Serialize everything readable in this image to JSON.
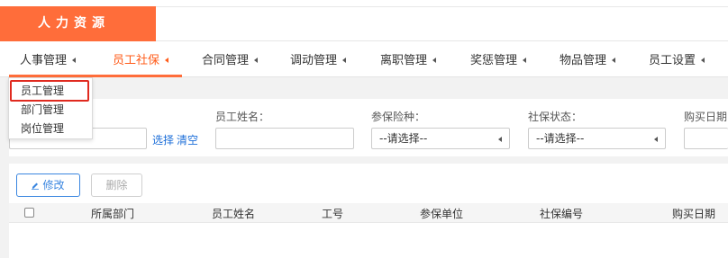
{
  "app": {
    "title": "人力资源",
    "brand_color": "#ff6d3a"
  },
  "nav": {
    "items": [
      {
        "label": "人事管理"
      },
      {
        "label": "员工社保"
      },
      {
        "label": "合同管理"
      },
      {
        "label": "调动管理"
      },
      {
        "label": "离职管理"
      },
      {
        "label": "奖惩管理"
      },
      {
        "label": "物品管理"
      },
      {
        "label": "员工设置"
      }
    ],
    "active_index": 1
  },
  "dropdown": {
    "items": [
      {
        "label": "员工管理",
        "highlighted": true
      },
      {
        "label": "部门管理"
      },
      {
        "label": "岗位管理"
      }
    ]
  },
  "filters": {
    "select_link": "选择",
    "clear_link": "清空",
    "employee_name": {
      "label": "员工姓名：",
      "value": ""
    },
    "insurance_type": {
      "label": "参保险种：",
      "value": "--请选择--"
    },
    "social_status": {
      "label": "社保状态：",
      "value": "--请选择--"
    },
    "purchase_date": {
      "label": "购买日期"
    }
  },
  "toolbar": {
    "edit_label": "修改",
    "delete_label": "删除"
  },
  "table": {
    "columns": [
      "所属部门",
      "员工姓名",
      "工号",
      "参保单位",
      "社保编号",
      "购买日期"
    ]
  }
}
